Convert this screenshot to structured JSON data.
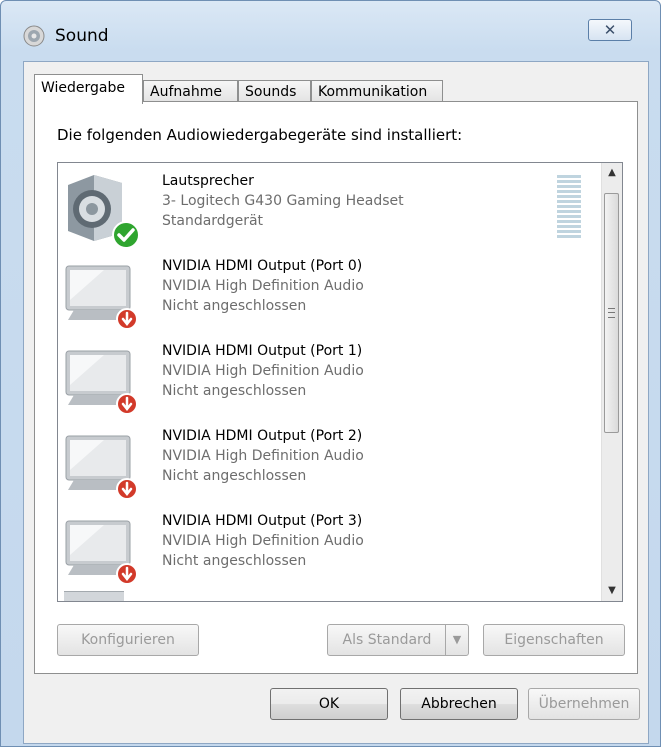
{
  "window": {
    "title": "Sound",
    "close_glyph": "✕"
  },
  "tabs": [
    {
      "label": "Wiedergabe",
      "active": true
    },
    {
      "label": "Aufnahme",
      "active": false
    },
    {
      "label": "Sounds",
      "active": false
    },
    {
      "label": "Kommunikation",
      "active": false
    }
  ],
  "panel": {
    "caption": "Die folgenden Audiowiedergabegeräte sind installiert:"
  },
  "devices": [
    {
      "name": "Lautsprecher",
      "sub": "3- Logitech G430 Gaming Headset",
      "status": "Standardgerät",
      "icon": "speaker-icon",
      "badge": "default-check-icon"
    },
    {
      "name": "NVIDIA HDMI Output (Port 0)",
      "sub": "NVIDIA High Definition Audio",
      "status": "Nicht angeschlossen",
      "icon": "monitor-icon",
      "badge": "unplugged-icon"
    },
    {
      "name": "NVIDIA HDMI Output (Port 1)",
      "sub": "NVIDIA High Definition Audio",
      "status": "Nicht angeschlossen",
      "icon": "monitor-icon",
      "badge": "unplugged-icon"
    },
    {
      "name": "NVIDIA HDMI Output (Port 2)",
      "sub": "NVIDIA High Definition Audio",
      "status": "Nicht angeschlossen",
      "icon": "monitor-icon",
      "badge": "unplugged-icon"
    },
    {
      "name": "NVIDIA HDMI Output (Port 3)",
      "sub": "NVIDIA High Definition Audio",
      "status": "Nicht angeschlossen",
      "icon": "monitor-icon",
      "badge": "unplugged-icon"
    }
  ],
  "buttons": {
    "configure": "Konfigurieren",
    "set_default": "Als Standard",
    "properties": "Eigenschaften",
    "ok": "OK",
    "cancel": "Abbrechen",
    "apply": "Übernehmen"
  },
  "colors": {
    "check": "#2fa52f",
    "unplugged": "#d23a2a"
  }
}
